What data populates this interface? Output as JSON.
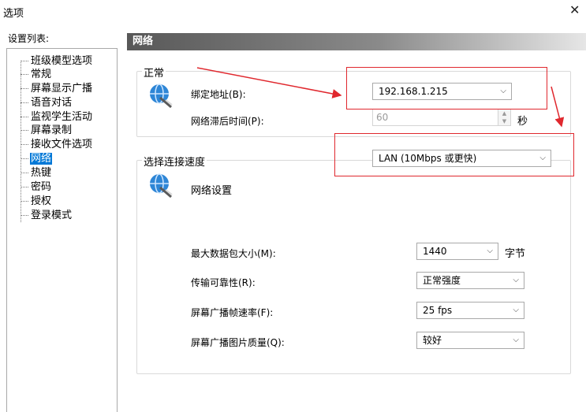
{
  "window": {
    "title": "选项",
    "close_glyph": "✕"
  },
  "sidebar": {
    "label": "设置列表:",
    "items": [
      {
        "label": "班级模型选项"
      },
      {
        "label": "常规"
      },
      {
        "label": "屏幕显示广播"
      },
      {
        "label": "语音对话"
      },
      {
        "label": "监视学生活动"
      },
      {
        "label": "屏幕录制"
      },
      {
        "label": "接收文件选项"
      },
      {
        "label": "网络",
        "selected": true
      },
      {
        "label": "热键"
      },
      {
        "label": "密码"
      },
      {
        "label": "授权"
      },
      {
        "label": "登录模式"
      }
    ]
  },
  "panel": {
    "title": "网络"
  },
  "general_group": {
    "title": "正常",
    "icon": "network-globe-icon",
    "bind_address_label": "绑定地址(B):",
    "bind_address_value": "192.168.1.215",
    "delay_label": "网络滞后时间(P):",
    "delay_value": "60",
    "delay_unit": "秒"
  },
  "speed_group": {
    "title": "选择连接速度",
    "speed_value": "LAN (10Mbps 或更快)",
    "icon": "network-globe-icon",
    "settings_label": "网络设置",
    "max_packet_label": "最大数据包大小(M):",
    "max_packet_value": "1440",
    "max_packet_unit": "字节",
    "reliability_label": "传输可靠性(R):",
    "reliability_value": "正常强度",
    "frame_rate_label": "屏幕广播帧速率(F):",
    "frame_rate_value": "25 fps",
    "quality_label": "屏幕广播图片质量(Q):",
    "quality_value": "较好"
  },
  "annotations": {
    "color": "#e0282e"
  }
}
